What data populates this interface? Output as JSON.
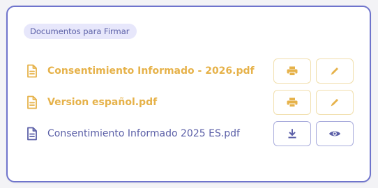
{
  "section": {
    "badge_label": "Documentos para Firmar"
  },
  "documents": [
    {
      "name": "Consentimiento Informado - 2026.pdf",
      "status": "pending",
      "actions": [
        "print-icon",
        "sign-pen-icon"
      ]
    },
    {
      "name": "Version español.pdf",
      "status": "pending",
      "actions": [
        "print-icon",
        "sign-pen-icon"
      ]
    },
    {
      "name": "Consentimiento Informado 2025 ES.pdf",
      "status": "signed",
      "actions": [
        "download-icon",
        "eye-icon"
      ]
    }
  ],
  "colors": {
    "card_border": "#6f74cc",
    "pending_accent": "#e6b24a",
    "signed_accent": "#5b5fa7",
    "badge_bg": "#e7e7fb",
    "badge_text": "#5d62a8"
  }
}
